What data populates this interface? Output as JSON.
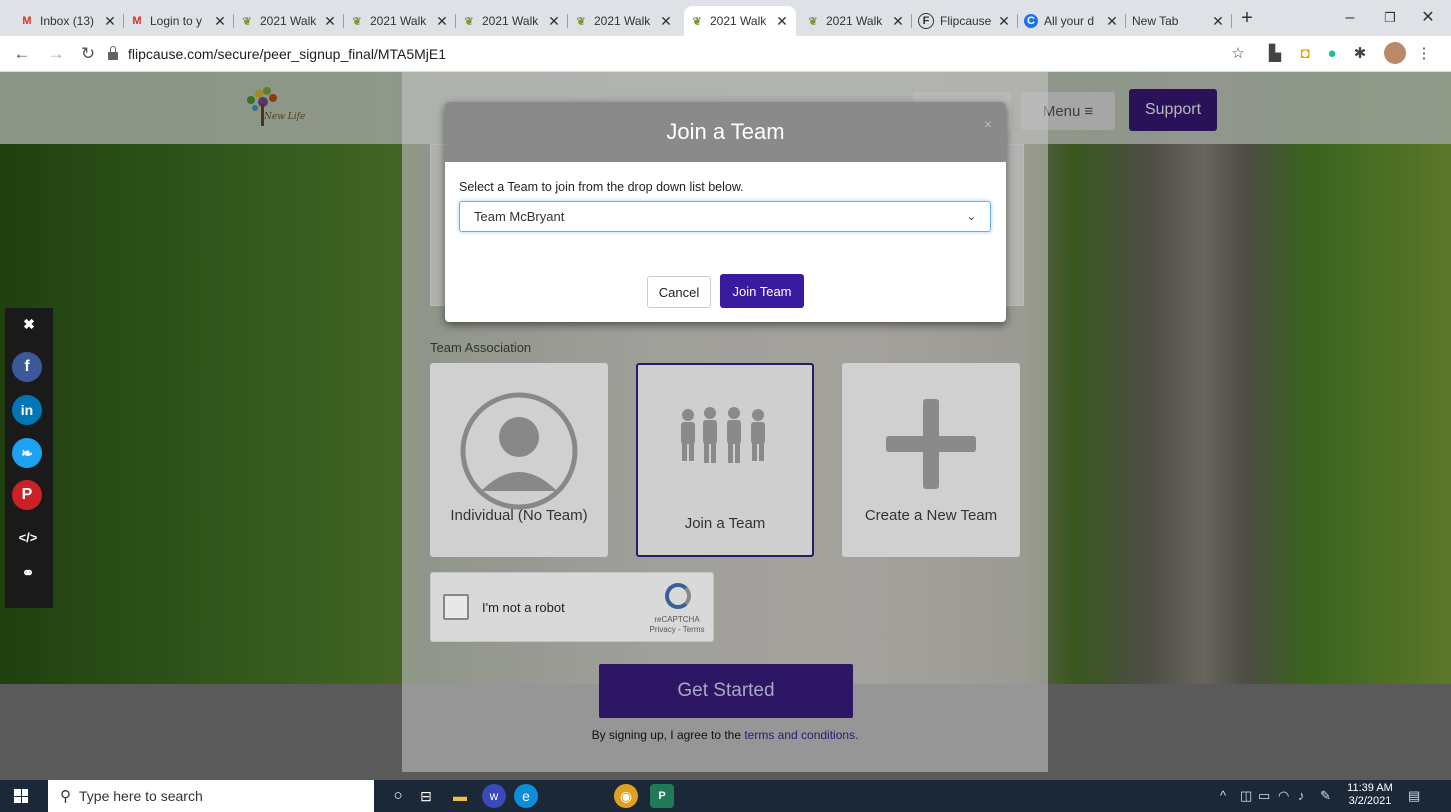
{
  "browser": {
    "tabs": [
      {
        "label": "Inbox (13)",
        "favicon": "gmail-icon",
        "active": false
      },
      {
        "label": "Login to y",
        "favicon": "gmail-icon",
        "active": false
      },
      {
        "label": "2021 Walk",
        "favicon": "walk-favicon",
        "active": false
      },
      {
        "label": "2021 Walk",
        "favicon": "walk-favicon",
        "active": false
      },
      {
        "label": "2021 Walk",
        "favicon": "walk-favicon",
        "active": false
      },
      {
        "label": "2021 Walk",
        "favicon": "walk-favicon",
        "active": false
      },
      {
        "label": "2021 Walk",
        "favicon": "walk-favicon",
        "active": true
      },
      {
        "label": "2021 Walk",
        "favicon": "walk-favicon",
        "active": false
      },
      {
        "label": "Flipcause",
        "favicon": "flipcause-icon",
        "active": false
      },
      {
        "label": "All your d",
        "favicon": "allyour-icon",
        "active": false
      },
      {
        "label": "New Tab",
        "favicon": "",
        "active": false
      }
    ],
    "url": "flipcause.com/secure/peer_signup_final/MTA5MjE1"
  },
  "site": {
    "logo_text": "New Life",
    "menu_label": "Menu",
    "support_label": "Support"
  },
  "form": {
    "team_association_label": "Team Association",
    "options": {
      "individual": "Individual (No Team)",
      "join": "Join a Team",
      "create": "Create a New Team"
    },
    "captcha": {
      "label": "I'm not a robot",
      "brand": "reCAPTCHA",
      "links": "Privacy - Terms"
    },
    "get_started": "Get Started",
    "agree_prefix": "By signing up, I agree to the ",
    "agree_link": "terms and conditions."
  },
  "modal": {
    "title": "Join a Team",
    "close": "×",
    "instruction": "Select a Team to join from the drop down list below.",
    "selected_team": "Team McBryant",
    "cancel_label": "Cancel",
    "join_label": "Join Team"
  },
  "taskbar": {
    "search_placeholder": "Type here to search",
    "time": "11:39 AM",
    "date": "3/2/2021"
  },
  "colors": {
    "brand_purple": "#3a1a9e",
    "support_purple": "#3a1a7a"
  }
}
